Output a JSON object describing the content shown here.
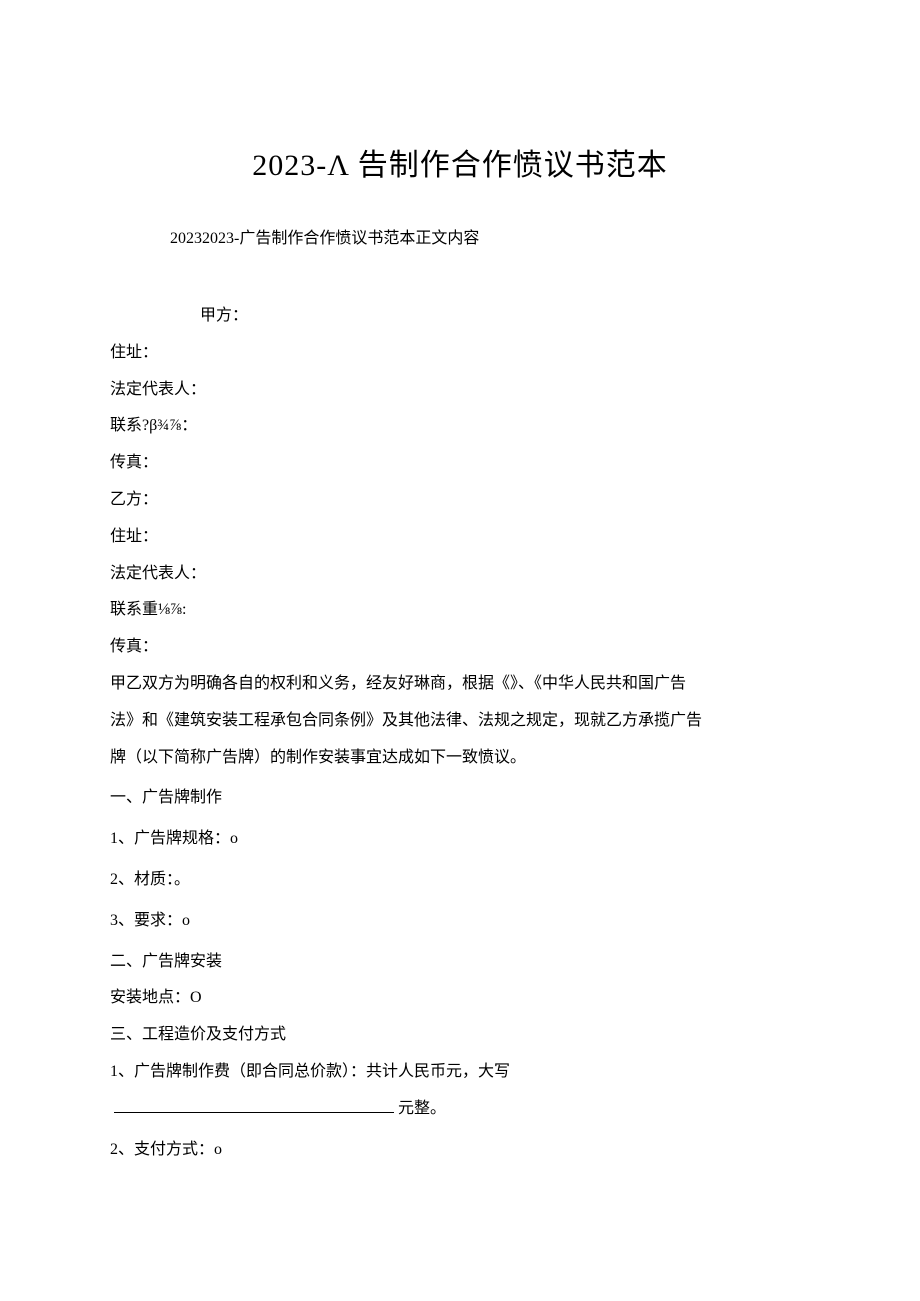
{
  "title": "2023-Λ 告制作合作愤议书范本",
  "subtitle": "20232023-广告制作合作愤议书范本正文内容",
  "fields": {
    "partyA": "甲方：",
    "addressA": "住址：",
    "legalRepA": "法定代表人：",
    "contactA": "联系?β¾⅞：",
    "faxA": "传真：",
    "partyB": "乙方：",
    "addressB": "住址：",
    "legalRepB": "法定代表人：",
    "contactB": "联系重⅛⅞:",
    "faxB": "传真："
  },
  "intro": {
    "l1": "甲乙双方为明确各自的权利和义务，经友好琳商，根据《》、《中华人民共和国广告",
    "l2": "法》和《建筑安装工程承包合同条例》及其他法律、法规之规定，现就乙方承揽广告",
    "l3": "牌（以下简称广告牌）的制作安装事宜达成如下一致愤议。"
  },
  "sections": {
    "s1": "一、广告牌制作",
    "s1_1": "1、广告牌规格：o",
    "s1_2": "2、材质：。",
    "s1_3": "3、要求：o",
    "s2": "二、广告牌安装",
    "s2_1": "安装地点：O",
    "s3": "三、工程造价及支付方式",
    "s3_1": "1、广告牌制作费（即合同总价款）：共计人民币元，大写",
    "s3_1_suffix": "元整。",
    "s3_2": "2、支付方式：o"
  }
}
